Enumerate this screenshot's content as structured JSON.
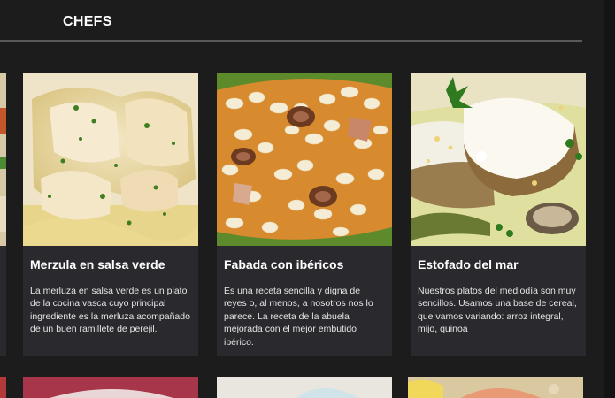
{
  "header": {
    "title": "CHEFS"
  },
  "cards": [
    {
      "title": "Merzula en salsa verde",
      "description": "La merluza en salsa verde es un plato de la cocina vasca cuyo principal ingrediente es la merluza acompañado de un buen ramillete de perejil.",
      "image_icon": "fish-dish-image"
    },
    {
      "title": "Fabada con ibéricos",
      "description": "Es una receta sencilla y digna de reyes o, al menos, a nosotros nos lo parece. La receta de la abuela mejorada con el mejor embutido ibérico.",
      "image_icon": "bean-stew-image"
    },
    {
      "title": "Estofado del mar",
      "description": "Nuestros platos del mediodía son muy sencillos. Usamos una base de cereal, que vamos variando: arroz integral, mijo, quinoa",
      "image_icon": "seafood-stew-image"
    }
  ]
}
